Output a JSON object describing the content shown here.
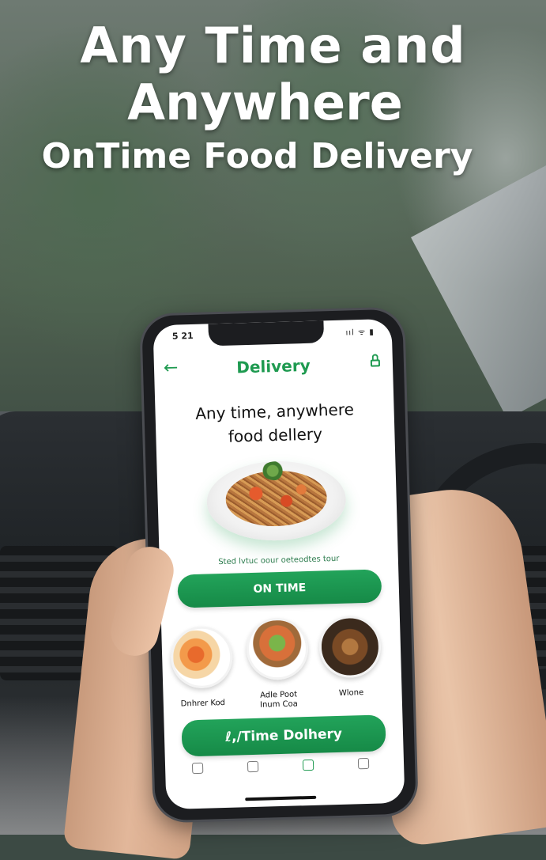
{
  "headline": {
    "line1": "Any Time  and",
    "line2": "Anywhere",
    "line3": "OnTime Food Delivery"
  },
  "phone": {
    "status": {
      "time": "5 21",
      "icons": "ııl ᯤ ▮"
    },
    "app_title": "Delivery",
    "tagline_line1": "Any time, anywhere",
    "tagline_line2": "food  dellery",
    "promo_note": "Sted lvtuc oour oeteodtes tour",
    "ontime_button": "ON TIME",
    "dishes": [
      {
        "label": "Dnhrer Kod"
      },
      {
        "label": "Adle Poot\nInum Coa"
      },
      {
        "label": "Wlone"
      }
    ],
    "delivery_button": "ℓ,/Time Dolhery",
    "nav": [
      {
        "label": ""
      },
      {
        "label": ""
      },
      {
        "label": ""
      },
      {
        "label": ""
      }
    ]
  },
  "colors": {
    "accent": "#1e9a50",
    "headline": "#ffffff"
  }
}
